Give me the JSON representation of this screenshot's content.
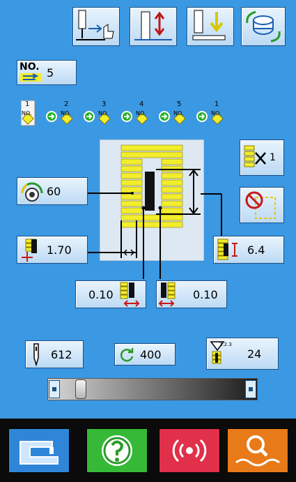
{
  "header": {
    "buttons": [
      {
        "icon": "needle-position-icon"
      },
      {
        "icon": "fabric-lift-icon"
      },
      {
        "icon": "presser-foot-icon"
      },
      {
        "icon": "bobbin-winding-icon"
      }
    ]
  },
  "pattern": {
    "no_label": "NO.",
    "no_value": "5"
  },
  "sequence": [
    "1",
    "2",
    "3",
    "4",
    "5",
    "1"
  ],
  "sequence_unit": "NO.",
  "stitch": {
    "repeat_value": "1",
    "speed_value": "60",
    "width_value": "1.70",
    "length_value": "6.4",
    "left_offset": "0.10",
    "right_offset": "0.10"
  },
  "counters": {
    "stitch_count": "612",
    "loop_count": "400",
    "pattern_count": "24"
  },
  "slider": {
    "level": 0.08
  },
  "bottom_bar": [
    {
      "name": "sewing-machine-button",
      "color": "#2f86d8"
    },
    {
      "name": "info-button",
      "color": "#36b936"
    },
    {
      "name": "wireless-button",
      "color": "#e0304a"
    },
    {
      "name": "search-button",
      "color": "#e87a19"
    }
  ],
  "colors": {
    "background": "#3b98e2",
    "accent_yellow": "#f2ee2c",
    "button_face": "#dceefc"
  }
}
